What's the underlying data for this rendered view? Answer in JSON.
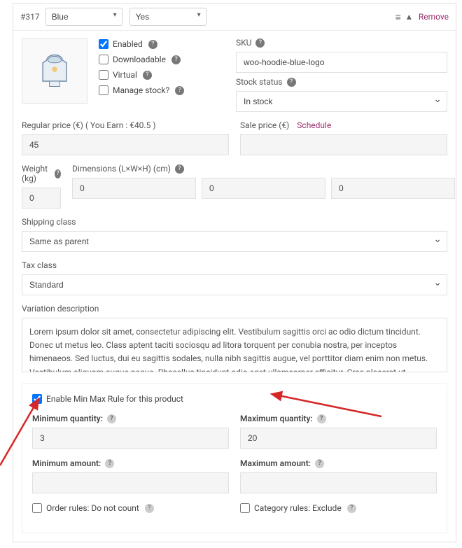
{
  "header": {
    "id": "#317",
    "attr1_value": "Blue",
    "attr2_value": "Yes",
    "remove": "Remove"
  },
  "checks": {
    "enabled": "Enabled",
    "downloadable": "Downloadable",
    "virtual": "Virtual",
    "manage_stock": "Manage stock?"
  },
  "sku": {
    "label": "SKU",
    "value": "woo-hoodie-blue-logo"
  },
  "stock_status": {
    "label": "Stock status",
    "value": "In stock"
  },
  "regular_price": {
    "label": "Regular price (€) ( You Earn : €40.5 )",
    "value": "45"
  },
  "sale_price": {
    "label": "Sale price (€)",
    "schedule": "Schedule",
    "value": ""
  },
  "weight": {
    "label": "Weight (kg)",
    "value": "0"
  },
  "dimensions": {
    "label": "Dimensions (L×W×H) (cm)",
    "l": "0",
    "w": "0",
    "h": "0"
  },
  "shipping_class": {
    "label": "Shipping class",
    "value": "Same as parent"
  },
  "tax_class": {
    "label": "Tax class",
    "value": "Standard"
  },
  "description": {
    "label": "Variation description",
    "value": "Lorem ipsum dolor sit amet, consectetur adipiscing elit. Vestibulum sagittis orci ac odio dictum tincidunt. Donec ut metus leo. Class aptent taciti sociosqu ad litora torquent per conubia nostra, per inceptos himenaeos. Sed luctus, dui eu sagittis sodales, nulla nibh sagittis augue, vel porttitor diam enim non metus. Vestibulum aliquam augue neque. Phasellus tincidunt odio eget ullamcorper efficitur. Cras placerat ut"
  },
  "minmax": {
    "enable": "Enable Min Max Rule for this product",
    "min_qty_label": "Minimum quantity:",
    "min_qty_value": "3",
    "max_qty_label": "Maximum quantity:",
    "max_qty_value": "20",
    "min_amt_label": "Minimum amount:",
    "max_amt_label": "Maximum amount:",
    "order_rules": "Order rules: Do not count",
    "category_rules": "Category rules: Exclude"
  }
}
